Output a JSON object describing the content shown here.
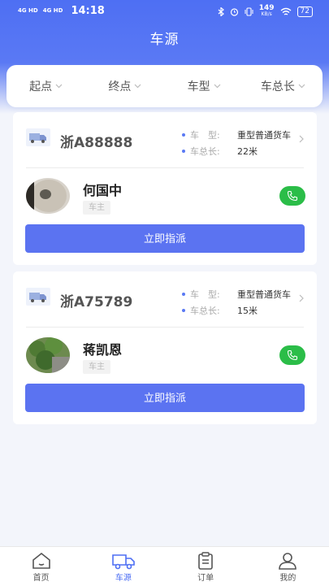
{
  "status_bar": {
    "signal1": "4G HD",
    "signal2": "4G HD",
    "time": "14:18",
    "net_speed_value": "149",
    "net_speed_unit": "KB/s",
    "battery": "72"
  },
  "header": {
    "title": "车源"
  },
  "filters": [
    {
      "label": "起点"
    },
    {
      "label": "终点"
    },
    {
      "label": "车型"
    },
    {
      "label": "车总长"
    }
  ],
  "vehicles": [
    {
      "plate": "浙A88888",
      "type_label": "车　型:",
      "type_value": "重型普通货车",
      "length_label": "车总长:",
      "length_value": "22米",
      "owner_name": "何国中",
      "owner_role": "车主",
      "assign_label": "立即指派"
    },
    {
      "plate": "浙A75789",
      "type_label": "车　型:",
      "type_value": "重型普通货车",
      "length_label": "车总长:",
      "length_value": "15米",
      "owner_name": "蒋凯恩",
      "owner_role": "车主",
      "assign_label": "立即指派"
    }
  ],
  "tabbar": {
    "items": [
      {
        "label": "首页",
        "icon": "home-icon",
        "active": false
      },
      {
        "label": "车源",
        "icon": "truck-icon",
        "active": true
      },
      {
        "label": "订单",
        "icon": "clipboard-icon",
        "active": false
      },
      {
        "label": "我的",
        "icon": "user-icon",
        "active": false
      }
    ]
  },
  "colors": {
    "primary": "#4e6ff3",
    "call_green": "#2bbd48",
    "background": "#f3f5fb"
  }
}
